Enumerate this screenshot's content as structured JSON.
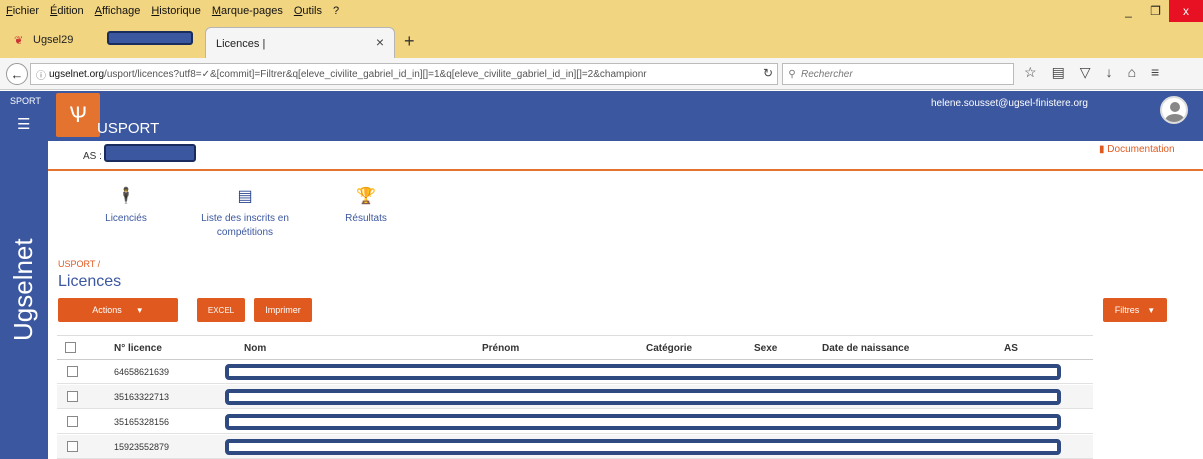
{
  "menu": [
    "Fichier",
    "Édition",
    "Affichage",
    "Historique",
    "Marque-pages",
    "Outils",
    "?"
  ],
  "window_controls": {
    "minimize": "_",
    "maximize": "❐",
    "close": "x"
  },
  "tabs": [
    {
      "label": "Ugsel29"
    },
    {
      "label": "Licences |",
      "close": "×"
    }
  ],
  "newtab_label": "+",
  "address": {
    "domain": "ugselnet.org",
    "path": "/usport/licences?utf8=✓&[commit]=Filtrer&q[eleve_civilite_gabriel_id_in][]=1&q[eleve_civilite_gabriel_id_in][]=2&championr"
  },
  "search": {
    "placeholder": "Rechercher"
  },
  "sidebar": {
    "sport_label": "SPORT",
    "brand_vertical": "Ugselnet"
  },
  "app": {
    "name": "USPORT",
    "user_email": "helene.sousset@ugsel-finistere.org"
  },
  "as_label": "AS : F",
  "documentation_label": "Documentation",
  "icon_nav": [
    {
      "label": "Licenciés",
      "icon": "person-icon"
    },
    {
      "label": "Liste des inscrits en compétitions",
      "icon": "list-icon"
    },
    {
      "label": "Résultats",
      "icon": "trophy-icon"
    }
  ],
  "breadcrumb": "USPORT /",
  "page_title": "Licences",
  "buttons": {
    "actions": "Actions",
    "excel": "EXCEL",
    "print": "Imprimer",
    "filters": "Filtres"
  },
  "table": {
    "headers": [
      "N° licence",
      "Nom",
      "Prénom",
      "Catégorie",
      "Sexe",
      "Date de naissance",
      "AS"
    ],
    "rows": [
      {
        "licence": "64658621639"
      },
      {
        "licence": "35163322713"
      },
      {
        "licence": "35165328156"
      },
      {
        "licence": "15923552879"
      }
    ]
  },
  "colors": {
    "brand_blue": "#3b57a0",
    "accent_orange": "#e05a20",
    "browser_bar": "#f2d580"
  }
}
